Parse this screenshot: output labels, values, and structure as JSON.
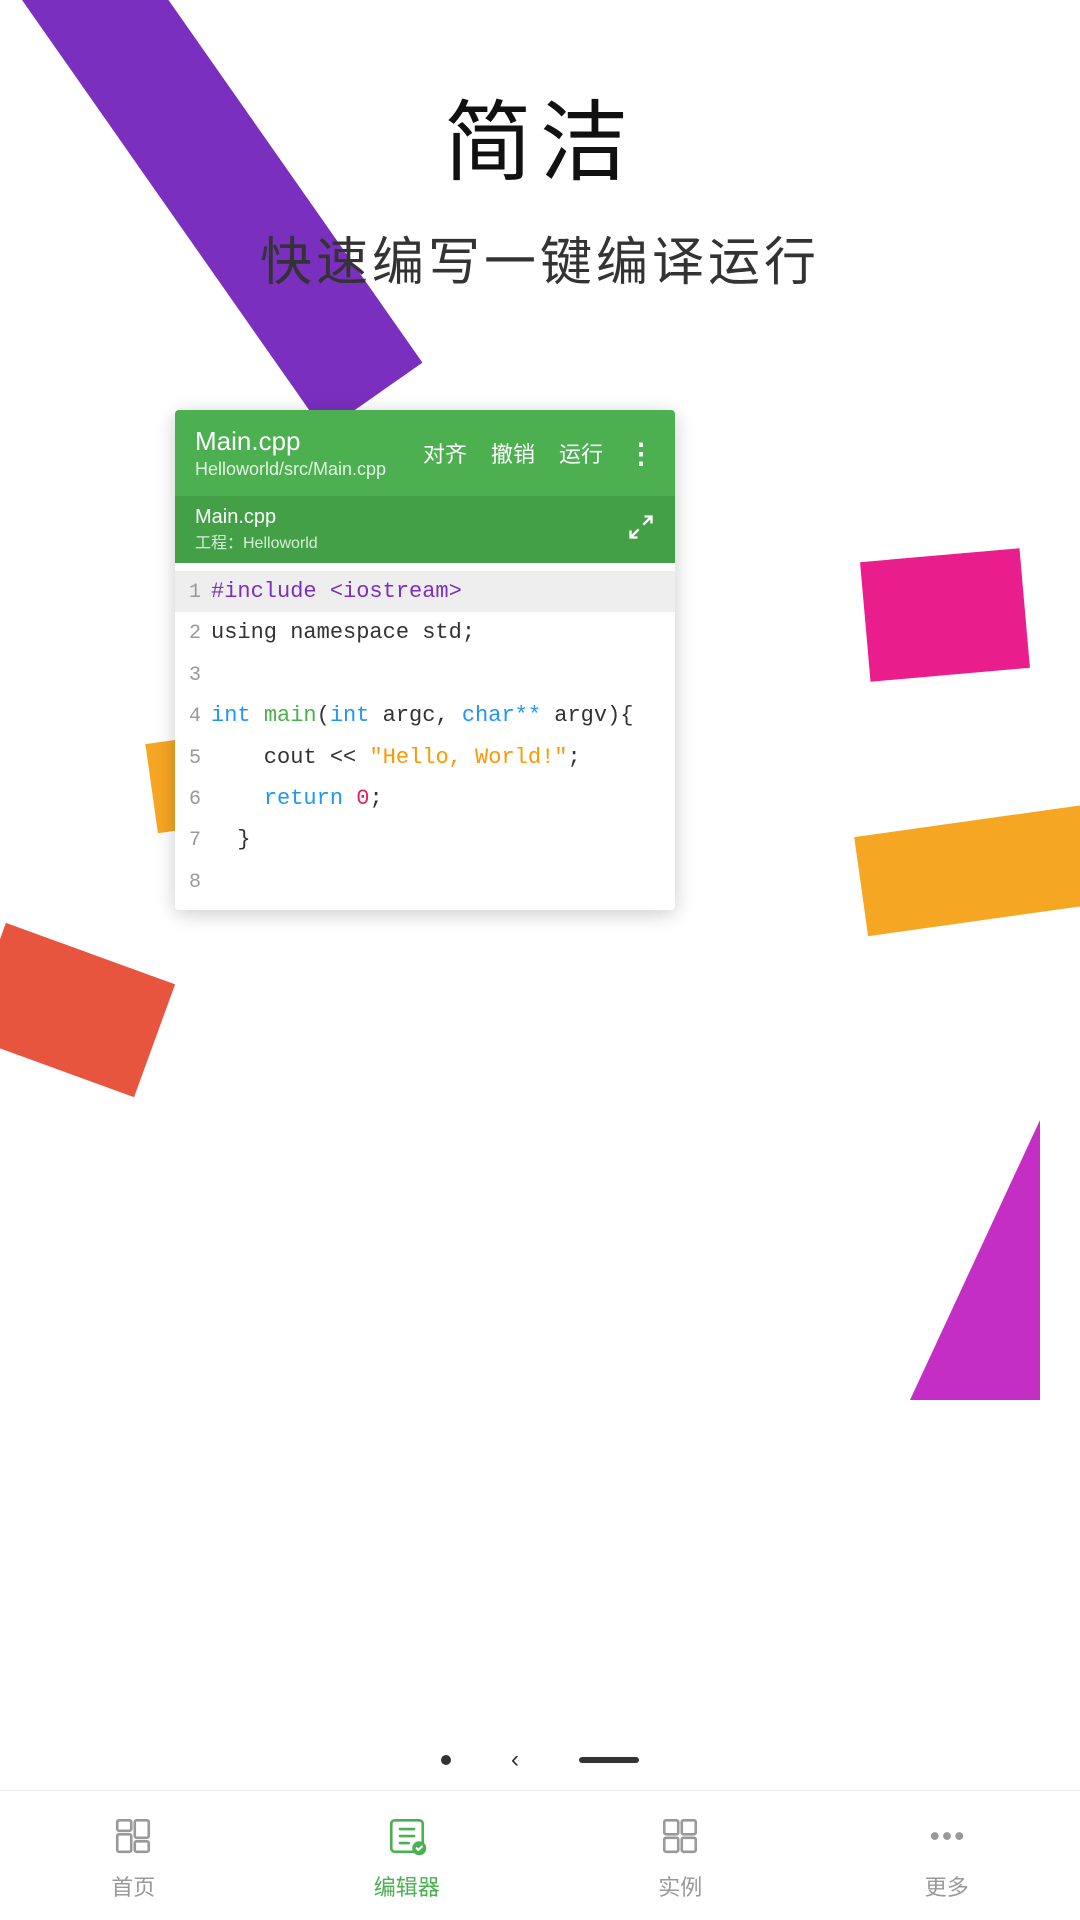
{
  "header": {
    "title": "简洁",
    "subtitle": "快速编写一键编译运行"
  },
  "editor": {
    "filename": "Main.cpp",
    "filepath": "Helloworld/src/Main.cpp",
    "tab_name": "Main.cpp",
    "tab_project": "工程：Helloworld",
    "actions": {
      "align": "对齐",
      "undo": "撤销",
      "run": "运行"
    },
    "code_lines": [
      {
        "num": "1",
        "content_raw": "#include <iostream>",
        "parts": [
          {
            "text": "#include <iostream>",
            "class": "c-preprocessor"
          }
        ]
      },
      {
        "num": "2",
        "content_raw": "using namespace std;",
        "parts": [
          {
            "text": "using namespace std;",
            "class": "c-text"
          }
        ]
      },
      {
        "num": "3",
        "content_raw": "",
        "parts": []
      },
      {
        "num": "4",
        "content_raw": "int main(int argc, char** argv){",
        "parts": [
          {
            "text": "int ",
            "class": "c-keyword"
          },
          {
            "text": "main(",
            "class": "c-function"
          },
          {
            "text": "int ",
            "class": "c-keyword"
          },
          {
            "text": "argc, ",
            "class": "c-text"
          },
          {
            "text": "char**",
            "class": "c-keyword"
          },
          {
            "text": " argv){",
            "class": "c-text"
          }
        ]
      },
      {
        "num": "5",
        "content_raw": "    cout << \"Hello, World!\";",
        "parts": [
          {
            "text": "    cout << ",
            "class": "c-text"
          },
          {
            "text": "\"Hello, World!\"",
            "class": "c-string"
          },
          {
            "text": ";",
            "class": "c-text"
          }
        ]
      },
      {
        "num": "6",
        "content_raw": "    return 0;",
        "parts": [
          {
            "text": "    ",
            "class": "c-text"
          },
          {
            "text": "return ",
            "class": "c-keyword"
          },
          {
            "text": "0",
            "class": "c-number"
          },
          {
            "text": ";",
            "class": "c-text"
          }
        ]
      },
      {
        "num": "7",
        "content_raw": "  }",
        "parts": [
          {
            "text": "  }",
            "class": "c-text"
          }
        ]
      },
      {
        "num": "8",
        "content_raw": "",
        "parts": []
      }
    ]
  },
  "bottom_nav": {
    "items": [
      {
        "id": "home",
        "label": "首页",
        "active": false
      },
      {
        "id": "editor",
        "label": "编辑器",
        "active": true
      },
      {
        "id": "examples",
        "label": "实例",
        "active": false
      },
      {
        "id": "more",
        "label": "更多",
        "active": false
      }
    ]
  }
}
